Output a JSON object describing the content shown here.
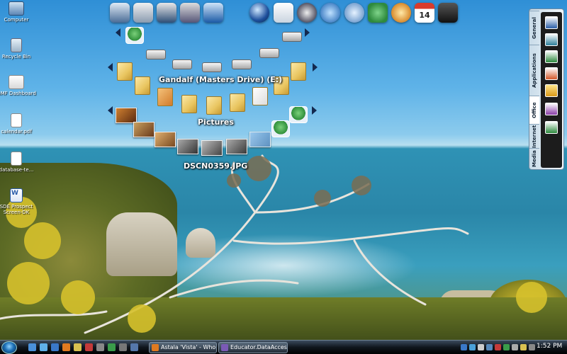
{
  "desktop_icons": [
    {
      "label": "Computer",
      "icon": "computer-icon"
    },
    {
      "label": "Recycle Bin",
      "icon": "recycle-bin-icon"
    },
    {
      "label": "GMF Dashboard",
      "icon": "gmail-dashboard-icon"
    },
    {
      "label": "calendar.pdf",
      "icon": "document-icon"
    },
    {
      "label": "database-te...",
      "icon": "document-icon"
    },
    {
      "label": "SDE Prospect Screen-DK",
      "icon": "word-document-icon"
    }
  ],
  "dock": {
    "icons": [
      "desktop-icon",
      "documents-icon",
      "programs-icon",
      "tools-icon",
      "network-icon",
      "globe-icon",
      "mail-icon",
      "media-player-icon",
      "weather-icon",
      "search-icon",
      "dragon-icon",
      "paint-icon",
      "calendar-icon",
      "shield-icon"
    ],
    "calendar_day": "14"
  },
  "fans": {
    "drives": {
      "label": "",
      "items": [
        "dvd-drive-icon",
        "drive-icon",
        "drive-icon",
        "drive-icon",
        "drive-icon",
        "dvd-drive-icon"
      ]
    },
    "folders": {
      "label": "Gandalf (Masters Drive) (E:)"
    },
    "pictures": {
      "label": "Pictures"
    },
    "photo": {
      "label": "DSCN0359.JPG"
    }
  },
  "side_panel": {
    "tabs": [
      "General",
      "Applications",
      "Office",
      "Internet",
      "Media"
    ],
    "active_tab": "Office",
    "apps": [
      "word-icon",
      "publisher-icon",
      "excel-icon",
      "powerpoint-icon",
      "outlook-icon",
      "onenote-icon",
      "excel-icon"
    ]
  },
  "taskbar": {
    "tasks": [
      {
        "label": "Astala 'Vista' - Who'...",
        "icon": "firefox-icon"
      },
      {
        "label": "Educator.DataAcces...",
        "icon": "visual-studio-icon"
      }
    ],
    "clock": "1:52 PM"
  },
  "colors": {
    "taskbar": "#10161d",
    "arrow": "#13294f",
    "label_text": "#ffffff"
  }
}
